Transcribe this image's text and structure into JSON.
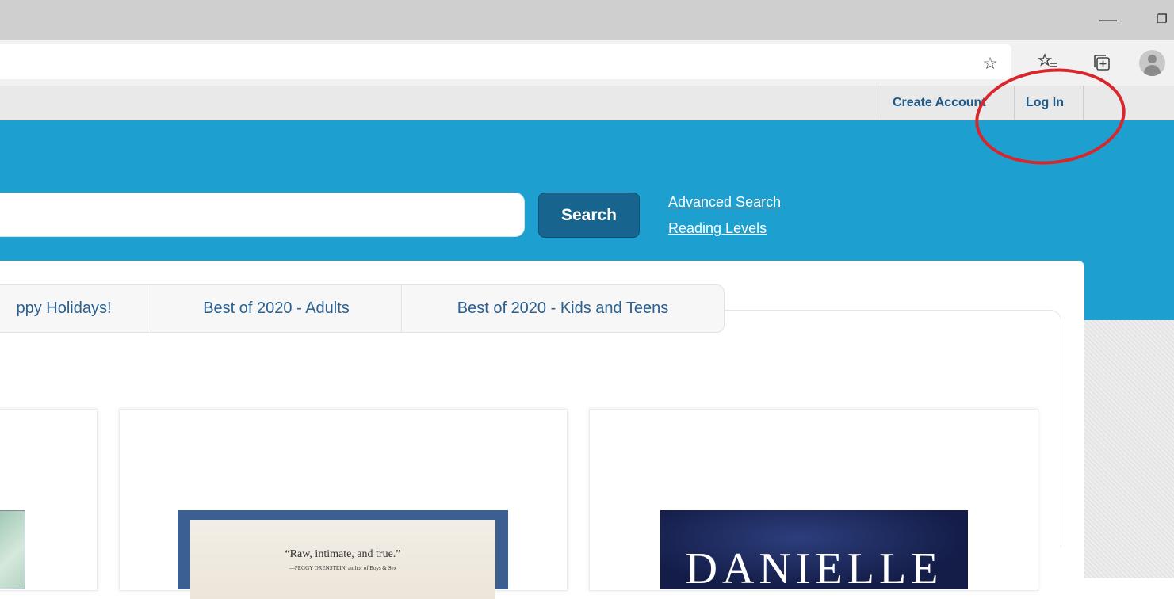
{
  "browser": {
    "window": {
      "minimize_glyph": "—",
      "restore_glyph": "❐"
    },
    "toolbar_icons": [
      "star-outline-icon",
      "favorites-list-icon",
      "collections-icon",
      "profile-avatar-icon"
    ]
  },
  "utility_nav": {
    "create_account": "Create Account",
    "log_in": "Log In"
  },
  "search": {
    "button_label": "Search",
    "advanced_link": "Advanced Search",
    "reading_levels_link": "Reading Levels"
  },
  "tabs": [
    {
      "label": "ppy Holidays!"
    },
    {
      "label": "Best of 2020 - Adults"
    },
    {
      "label": "Best of 2020 - Kids and Teens"
    }
  ],
  "books": [
    {
      "quote": "“Raw, intimate, and true.”",
      "quote_attribution": "—PEGGY ORENSTEIN, author of Boys & Sex"
    },
    {
      "cover_title": "DANIELLE"
    }
  ],
  "annotation": {
    "color": "#d9262b",
    "target": "Log In"
  },
  "colors": {
    "header_blue": "#1d9fd0",
    "search_button": "#17658f",
    "link_blue": "#1f5a88"
  }
}
